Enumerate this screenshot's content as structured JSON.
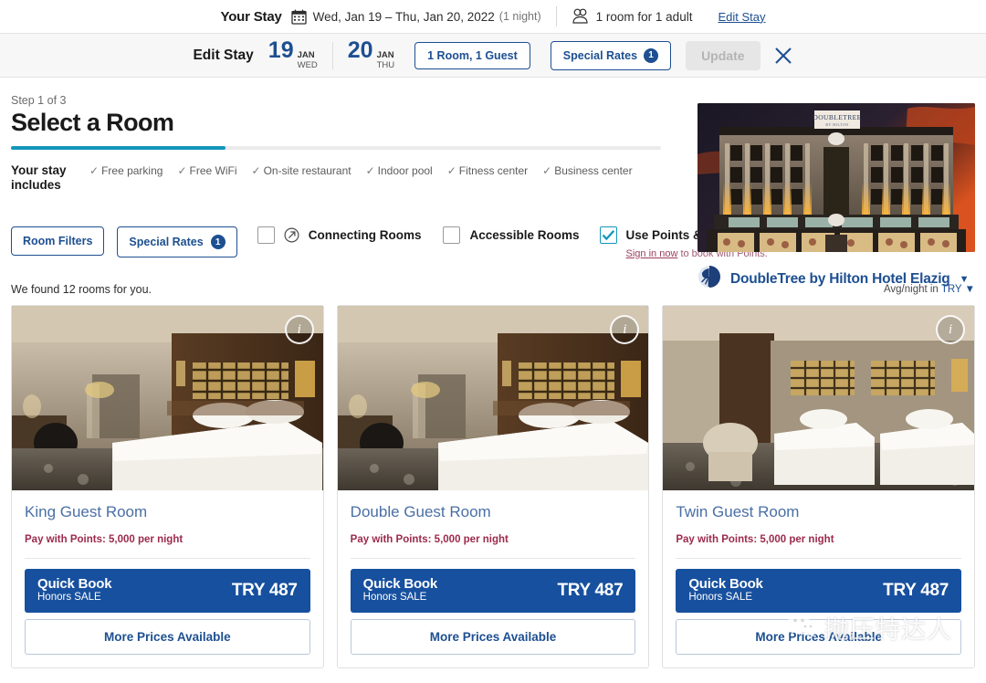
{
  "your_stay": {
    "label": "Your Stay",
    "calendar_icon": "calendar-icon",
    "dates": "Wed, Jan 19 – Thu, Jan 20, 2022",
    "nights": "(1 night)",
    "guest_icon": "guests-icon",
    "occupancy": "1 room for 1 adult",
    "edit_link": "Edit Stay"
  },
  "edit_stay": {
    "title": "Edit Stay",
    "checkin": {
      "day": "19",
      "month": "JAN",
      "weekday": "WED"
    },
    "checkout": {
      "day": "20",
      "month": "JAN",
      "weekday": "THU"
    },
    "rooms_guests": "1 Room, 1 Guest",
    "special_rates": "Special Rates",
    "special_rates_count": "1",
    "update": "Update",
    "close_icon": "close-icon"
  },
  "header": {
    "step": "Step 1 of 3",
    "title": "Select a Room",
    "progress_percent": 33
  },
  "includes": {
    "label": "Your stay includes",
    "amenities": [
      "Free parking",
      "Free WiFi",
      "On-site restaurant",
      "Indoor pool",
      "Fitness center",
      "Business center"
    ]
  },
  "filters": {
    "room_filters": "Room Filters",
    "special_rates": "Special Rates",
    "special_rates_count": "1",
    "connecting_rooms": "Connecting Rooms",
    "connecting_rooms_checked": false,
    "accessible_rooms": "Accessible Rooms",
    "accessible_rooms_checked": false,
    "use_points": "Use Points & Money",
    "use_points_checked": true,
    "points_note_link": "Sign in now",
    "points_note_rest": " to book with Points."
  },
  "hotel": {
    "name": "DoubleTree by Hilton Hotel Elazig",
    "logo_icon": "doubletree-tree-icon",
    "caret_icon": "chevron-down-icon",
    "photo_caption": "DoubleTree by Hilton hotel exterior at dusk"
  },
  "results": {
    "count_text": "We found 12 rooms for you.",
    "avg_prefix": "Avg/night in ",
    "currency": "TRY",
    "caret_icon": "chevron-down-icon"
  },
  "rooms": [
    {
      "name": "King Guest Room",
      "points": "Pay with Points: 5,000 per night",
      "quick_book": "Quick Book",
      "rate_name": "Honors SALE",
      "price": "TRY 487",
      "more_prices": "More Prices Available",
      "info_icon": "info-icon"
    },
    {
      "name": "Double Guest Room",
      "points": "Pay with Points: 5,000 per night",
      "quick_book": "Quick Book",
      "rate_name": "Honors SALE",
      "price": "TRY 487",
      "more_prices": "More Prices Available",
      "info_icon": "info-icon"
    },
    {
      "name": "Twin Guest Room",
      "points": "Pay with Points: 5,000 per night",
      "quick_book": "Quick Book",
      "rate_name": "Honors SALE",
      "price": "TRY 487",
      "more_prices": "More Prices Available",
      "info_icon": "info-icon"
    }
  ],
  "watermark": {
    "icon": "wechat-icon",
    "text": "抛压特达人"
  },
  "colors": {
    "brand_blue": "#1d4f91",
    "quick_book_blue": "#17509e",
    "progress_teal": "#1496bb",
    "points_maroon": "#9c2a4d"
  }
}
